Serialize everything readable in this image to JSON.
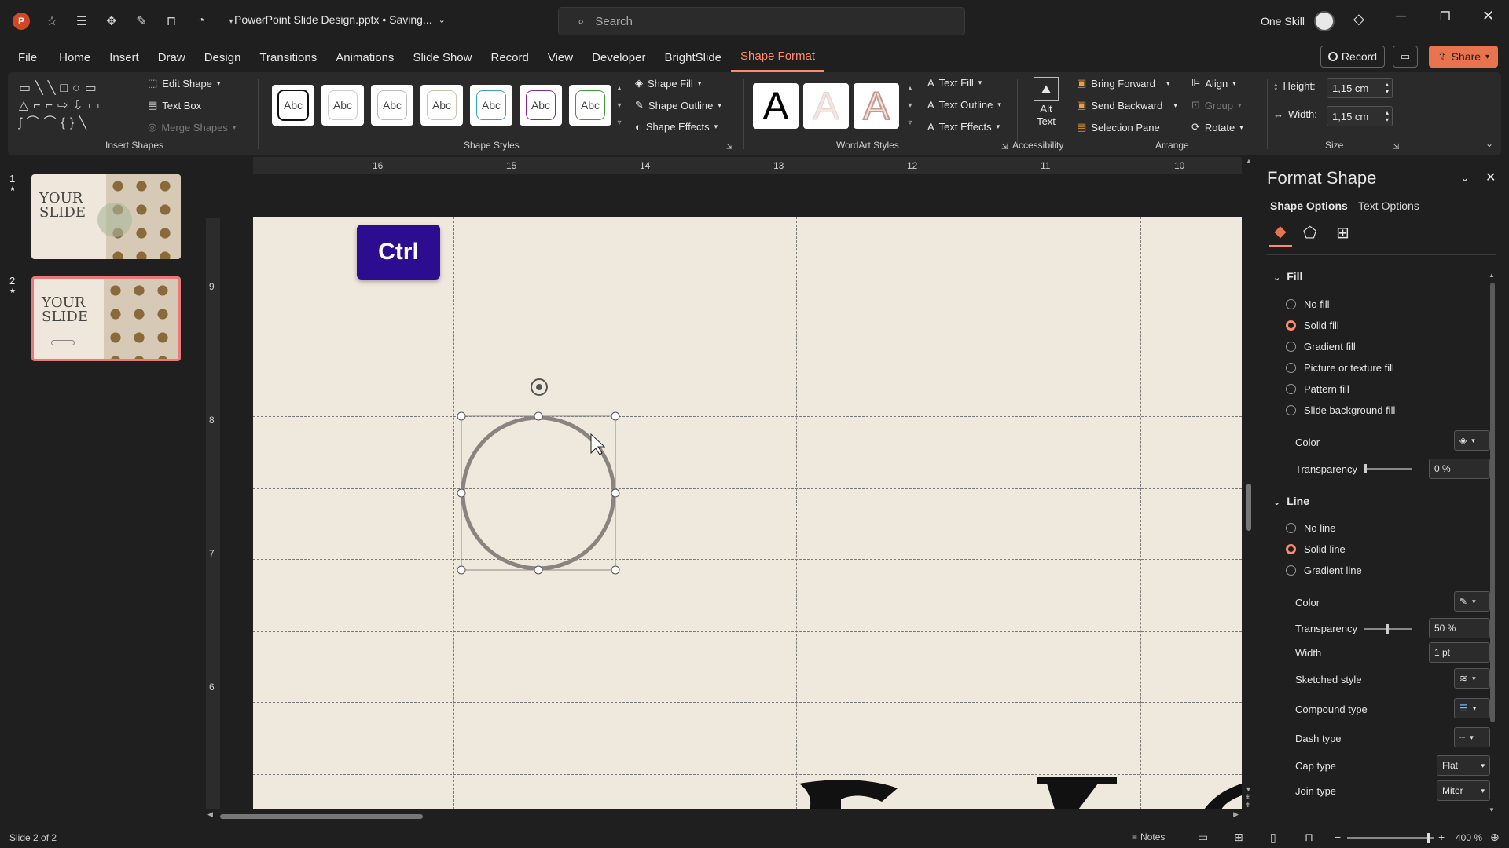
{
  "title_bar": {
    "file_name": "PowerPoint Slide Design.pptx • Saving...",
    "search_placeholder": "Search",
    "user_name": "One Skill",
    "window_controls": [
      "minimize-icon",
      "restore-icon",
      "close-icon"
    ]
  },
  "menu": {
    "items": [
      "File",
      "Home",
      "Insert",
      "Draw",
      "Design",
      "Transitions",
      "Animations",
      "Slide Show",
      "Record",
      "View",
      "Developer",
      "BrightSlide",
      "Shape Format"
    ],
    "active": "Shape Format",
    "record_button": "Record",
    "share_button": "Share"
  },
  "ribbon": {
    "insert_shapes": {
      "label": "Insert Shapes",
      "edit_shape": "Edit Shape",
      "text_box": "Text Box",
      "merge_shapes": "Merge Shapes"
    },
    "shape_styles": {
      "label": "Shape Styles",
      "thumbs": [
        "Abc",
        "Abc",
        "Abc",
        "Abc",
        "Abc",
        "Abc",
        "Abc"
      ],
      "thumb_colors": [
        "#111111",
        "#cccccc",
        "#bbbbbb",
        "#c9c2b2",
        "#3aa0c8",
        "#8a2b8a",
        "#3c9a3c"
      ],
      "shape_fill": "Shape Fill",
      "shape_outline": "Shape Outline",
      "shape_effects": "Shape Effects"
    },
    "wordart_styles": {
      "label": "WordArt Styles",
      "letters": [
        "A",
        "A",
        "A"
      ],
      "text_fill": "Text Fill",
      "text_outline": "Text Outline",
      "text_effects": "Text Effects"
    },
    "accessibility": {
      "label": "Accessibility",
      "alt_text_line1": "Alt",
      "alt_text_line2": "Text"
    },
    "arrange": {
      "label": "Arrange",
      "bring_forward": "Bring Forward",
      "send_backward": "Send Backward",
      "selection_pane": "Selection Pane",
      "align": "Align",
      "group": "Group",
      "rotate": "Rotate"
    },
    "size": {
      "label": "Size",
      "height_label": "Height:",
      "height_value": "1,15 cm",
      "width_label": "Width:",
      "width_value": "1,15 cm"
    }
  },
  "thumbnails": [
    {
      "number": "1",
      "title_line1": "YOUR",
      "title_line2": "SLIDE",
      "selected": false
    },
    {
      "number": "2",
      "title_line1": "YOUR",
      "title_line2": "SLIDE",
      "selected": true
    }
  ],
  "ruler": {
    "top": [
      "16",
      "15",
      "14",
      "13",
      "12",
      "11",
      "10"
    ],
    "left": [
      "9",
      "8",
      "7",
      "6"
    ]
  },
  "slide": {
    "ctrl_badge": "Ctrl",
    "circle_stroke": "#8a8480"
  },
  "format_pane": {
    "title": "Format Shape",
    "tabs": [
      "Shape Options",
      "Text Options"
    ],
    "fill": {
      "header": "Fill",
      "options": [
        "No fill",
        "Solid fill",
        "Gradient fill",
        "Picture or texture fill",
        "Pattern fill",
        "Slide background fill"
      ],
      "selected": "Solid fill",
      "color_label": "Color",
      "transparency_label": "Transparency",
      "transparency_value": "0 %"
    },
    "line": {
      "header": "Line",
      "options": [
        "No line",
        "Solid line",
        "Gradient line"
      ],
      "selected": "Solid line",
      "color_label": "Color",
      "transparency_label": "Transparency",
      "transparency_value": "50 %",
      "width_label": "Width",
      "width_value": "1 pt",
      "sketched_label": "Sketched style",
      "compound_label": "Compound type",
      "dash_label": "Dash type",
      "cap_label": "Cap type",
      "cap_value": "Flat",
      "join_label": "Join type",
      "join_value": "Miter"
    }
  },
  "status": {
    "slide_info": "Slide 2 of 2",
    "notes": "Notes",
    "zoom": "400 %"
  },
  "colors": {
    "accent": "#ff8a6a",
    "ctrl_badge": "#2c0d8f",
    "slide_bg": "#efe8dc"
  }
}
